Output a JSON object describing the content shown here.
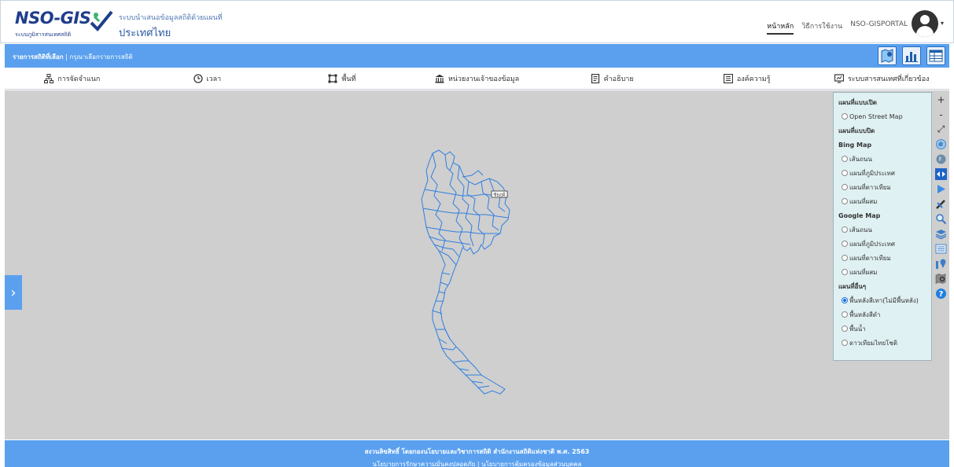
{
  "brand": {
    "logo_text": "NSO-GIS",
    "logo_sub": "ระบบภูมิสารสนเทศสถิติ",
    "title_line1": "ระบบนำเสนอข้อมูลสถิติด้วยแผนที่",
    "title_line2": "ประเทศไทย"
  },
  "topnav": {
    "home": "หน้าหลัก",
    "howto": "วิธีการใช้งาน",
    "portal": "NSO-GISPORTAL"
  },
  "breadcrumb": {
    "label": "รายการสถิติที่เลือก",
    "value": "กรุณาเลือกรายการสถิติ"
  },
  "menu": [
    {
      "icon": "hierarchy-icon",
      "label": "การจัดจำแนก"
    },
    {
      "icon": "clock-icon",
      "label": "เวลา"
    },
    {
      "icon": "area-icon",
      "label": "พื้นที่"
    },
    {
      "icon": "agency-icon",
      "label": "หน่วยงานเจ้าของข้อมูล"
    },
    {
      "icon": "book-icon",
      "label": "คำอธิบาย"
    },
    {
      "icon": "document-icon",
      "label": "องค์ความรู้"
    },
    {
      "icon": "system-icon",
      "label": "ระบบสารสนเทศที่เกี่ยวข้อง"
    }
  ],
  "layers": {
    "open_head": "แผนที่แบบเปิด",
    "osm": "Open Street Map",
    "closed_head": "แผนที่แบบปิด",
    "bing_head": "Bing Map",
    "bing": [
      "เส้นถนน",
      "แผนที่ภูมิประเทศ",
      "แผนที่ดาวเทียม",
      "แผนที่ผสม"
    ],
    "google_head": "Google Map",
    "google": [
      "เส้นถนน",
      "แผนที่ภูมิประเทศ",
      "แผนที่ดาวเทียม",
      "แผนที่ผสม"
    ],
    "other_head": "แผนที่อื่นๆ",
    "other": [
      "พื้นหลังสีเทา(ไม่มีพื้นหลัง)",
      "พื้นหลังสีดำ",
      "พื้นน้ำ",
      "ดาวเทียมไทยโชติ"
    ],
    "selected": "พื้นหลังสีเทา(ไม่มีพื้นหลัง)"
  },
  "tools": {
    "zoom_in": "+",
    "zoom_out": "-",
    "fullscreen": "⤢",
    "help": "?"
  },
  "map_label": "ชัยภูมิ",
  "footer": {
    "line1": "สงวนลิขสิทธิ์ โดยกองนโยบายและวิชาการสถิติ สำนักงานสถิติแห่งชาติ พ.ศ. 2563",
    "line2": "นโยบายการรักษาความมั่นคงปลอดภัย | นโยบายการคุ้มครองข้อมูลส่วนบุคคล"
  },
  "colors": {
    "accent": "#5aa0ef",
    "map_bg": "#cfcfcf",
    "boundary": "#2f7fe0",
    "panel_bg": "#e0f1f3"
  }
}
